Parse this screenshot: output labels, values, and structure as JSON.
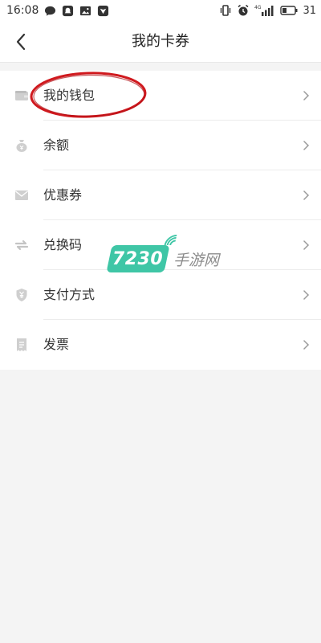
{
  "status_bar": {
    "time": "16:08",
    "left_icons": [
      "message-bubble-icon",
      "notification-bell-icon",
      "image-icon",
      "shield-app-icon"
    ],
    "right_icons": [
      "vibrate-icon",
      "alarm-icon",
      "signal-icon"
    ],
    "network_label": "4G",
    "battery_level": "31"
  },
  "nav": {
    "title": "我的卡券",
    "back_icon": "chevron-left-icon"
  },
  "menu": {
    "items": [
      {
        "label": "我的钱包",
        "icon": "wallet-icon"
      },
      {
        "label": "余额",
        "icon": "money-bag-icon"
      },
      {
        "label": "优惠券",
        "icon": "envelope-coupon-icon"
      },
      {
        "label": "兑换码",
        "icon": "exchange-arrows-icon"
      },
      {
        "label": "支付方式",
        "icon": "yuan-shield-icon"
      },
      {
        "label": "发票",
        "icon": "receipt-icon"
      }
    ]
  },
  "highlight": {
    "target": "我的钱包",
    "color": "#d0191e"
  },
  "watermark": {
    "number": "7230",
    "text": "手游网",
    "color": "#3fc6a6"
  },
  "colors": {
    "background": "#f4f4f4",
    "surface": "#ffffff",
    "icon": "#c8c8c8",
    "text": "#333333"
  }
}
